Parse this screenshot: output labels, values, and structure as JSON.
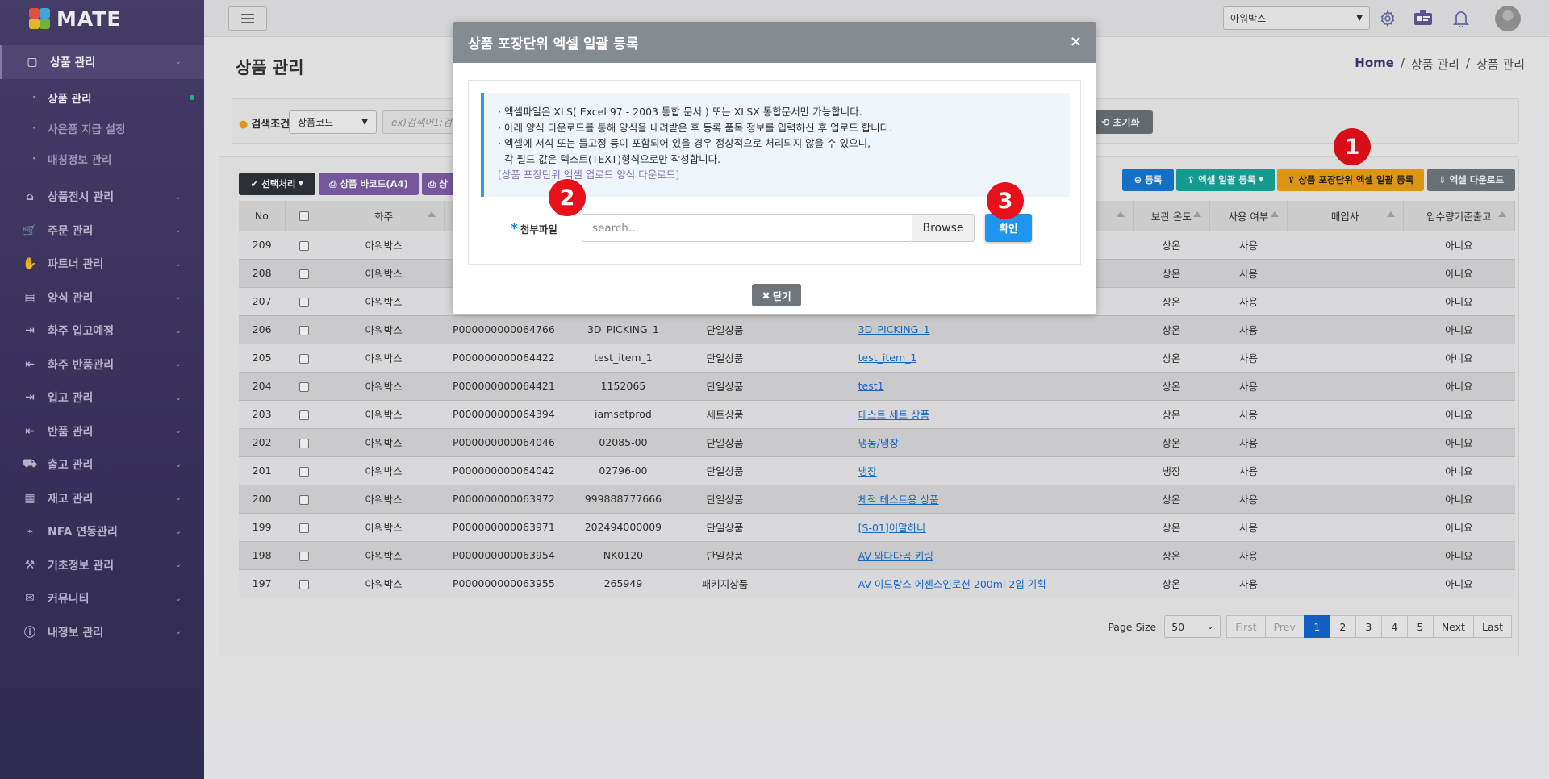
{
  "app": {
    "logo_text": "MATE"
  },
  "sidebar": {
    "items": [
      {
        "label": "상품 관리",
        "icon": "box-icon",
        "active": true,
        "children": [
          {
            "label": "상품 관리",
            "active": true
          },
          {
            "label": "사은품 지급 설정",
            "active": false
          },
          {
            "label": "매칭정보 관리",
            "active": false
          }
        ]
      },
      {
        "label": "상품전시 관리",
        "icon": "store-icon"
      },
      {
        "label": "주문 관리",
        "icon": "cart-icon"
      },
      {
        "label": "파트너 관리",
        "icon": "handshake-icon"
      },
      {
        "label": "양식 관리",
        "icon": "document-icon"
      },
      {
        "label": "화주 입고예정",
        "icon": "login-icon"
      },
      {
        "label": "화주 반품관리",
        "icon": "logout-icon"
      },
      {
        "label": "입고 관리",
        "icon": "login-icon"
      },
      {
        "label": "반품 관리",
        "icon": "logout-icon"
      },
      {
        "label": "출고 관리",
        "icon": "truck-icon"
      },
      {
        "label": "재고 관리",
        "icon": "boxes-icon"
      },
      {
        "label": "NFA 연동관리",
        "icon": "plug-icon"
      },
      {
        "label": "기초정보 관리",
        "icon": "wrench-icon"
      },
      {
        "label": "커뮤니티",
        "icon": "chat-icon"
      },
      {
        "label": "내정보 관리",
        "icon": "info-icon"
      }
    ]
  },
  "topbar": {
    "company_selected": "아워박스"
  },
  "page": {
    "title": "상품 관리",
    "breadcrumb": [
      "Home",
      "/",
      "상품 관리",
      "/",
      "상품 관리"
    ]
  },
  "search": {
    "label": "검색조건",
    "field_selected": "상품코드",
    "placeholder": "ex)검색어1;검색",
    "reset_label": "초기화"
  },
  "toolbar": {
    "select_action": "선택처리",
    "barcode_a4": "상품 바코드(A4)",
    "barcode_partial": "상",
    "register": "등록",
    "excel_bulk": "엑셀 일괄 등록",
    "package_excel_bulk": "상품 포장단위 엑셀 일괄 등록",
    "excel_download": "엑셀 다운로드"
  },
  "table": {
    "columns": [
      "No",
      "",
      "화주",
      "",
      "",
      "",
      "",
      "보관 온도",
      "사용 여부",
      "매입사",
      "입수량기준출고"
    ],
    "rows": [
      {
        "no": "209",
        "owner": "아워박스",
        "code": "",
        "sku": "",
        "type": "",
        "name": "",
        "temp": "상온",
        "use": "사용",
        "buyer": "",
        "qty": "아니요"
      },
      {
        "no": "208",
        "owner": "아워박스",
        "code": "",
        "sku": "",
        "type": "",
        "name": "",
        "temp": "상온",
        "use": "사용",
        "buyer": "",
        "qty": "아니요"
      },
      {
        "no": "207",
        "owner": "아워박스",
        "code": "",
        "sku": "",
        "type": "",
        "name": "",
        "temp": "상온",
        "use": "사용",
        "buyer": "",
        "qty": "아니요"
      },
      {
        "no": "206",
        "owner": "아워박스",
        "code": "P000000000064766",
        "sku": "3D_PICKING_1",
        "type": "단일상품",
        "name": "3D_PICKING_1",
        "temp": "상온",
        "use": "사용",
        "buyer": "",
        "qty": "아니요"
      },
      {
        "no": "205",
        "owner": "아워박스",
        "code": "P000000000064422",
        "sku": "test_item_1",
        "type": "단일상품",
        "name": "test_item_1",
        "temp": "상온",
        "use": "사용",
        "buyer": "",
        "qty": "아니요"
      },
      {
        "no": "204",
        "owner": "아워박스",
        "code": "P000000000064421",
        "sku": "1152065",
        "type": "단일상품",
        "name": "test1",
        "temp": "상온",
        "use": "사용",
        "buyer": "",
        "qty": "아니요"
      },
      {
        "no": "203",
        "owner": "아워박스",
        "code": "P000000000064394",
        "sku": "iamsetprod",
        "type": "세트상품",
        "name": "테스트 세트 상품",
        "temp": "상온",
        "use": "사용",
        "buyer": "",
        "qty": "아니요"
      },
      {
        "no": "202",
        "owner": "아워박스",
        "code": "P000000000064046",
        "sku": "02085-00",
        "type": "단일상품",
        "name": "냉동/냉장",
        "temp": "상온",
        "use": "사용",
        "buyer": "",
        "qty": "아니요"
      },
      {
        "no": "201",
        "owner": "아워박스",
        "code": "P000000000064042",
        "sku": "02796-00",
        "type": "단일상품",
        "name": "냉장",
        "temp": "냉장",
        "use": "사용",
        "buyer": "",
        "qty": "아니요"
      },
      {
        "no": "200",
        "owner": "아워박스",
        "code": "P000000000063972",
        "sku": "999888777666",
        "type": "단일상품",
        "name": "체적 테스트용 상품",
        "temp": "상온",
        "use": "사용",
        "buyer": "",
        "qty": "아니요"
      },
      {
        "no": "199",
        "owner": "아워박스",
        "code": "P000000000063971",
        "sku": "202494000009",
        "type": "단일상품",
        "name": "[S-01]이말하나",
        "temp": "상온",
        "use": "사용",
        "buyer": "",
        "qty": "아니요"
      },
      {
        "no": "198",
        "owner": "아워박스",
        "code": "P000000000063954",
        "sku": "NK0120",
        "type": "단일상품",
        "name": "AV 와다다곰 키링",
        "temp": "상온",
        "use": "사용",
        "buyer": "",
        "qty": "아니요"
      },
      {
        "no": "197",
        "owner": "아워박스",
        "code": "P000000000063955",
        "sku": "265949",
        "type": "패키지상품",
        "name": "AV 이드랑스 에센스인로션 200ml 2입 기획",
        "temp": "상온",
        "use": "사용",
        "buyer": "",
        "qty": "아니요"
      }
    ]
  },
  "pager": {
    "page_size_label": "Page Size",
    "page_size": "50",
    "first": "First",
    "prev": "Prev",
    "pages": [
      "1",
      "2",
      "3",
      "4",
      "5"
    ],
    "current": "1",
    "next": "Next",
    "last": "Last"
  },
  "modal": {
    "title": "상품 포장단위 엑셀 일괄 등록",
    "close_symbol": "×",
    "info_lines": [
      "· 엑셀파일은 XLS( Excel 97 - 2003 통합 문서 ) 또는 XLSX 통합문서만 가능합니다.",
      "· 아래 양식 다운로드를 통해 양식을 내려받은 후 등록 품목 정보를 입력하신 후 업로드 합니다.",
      "· 엑셀에 서식 또는 틀고정 등이 포함되어 있을 경우 정상적으로 처리되지 않을 수 있으니,",
      "  각 필드 값은 텍스트(TEXT)형식으로만 작성합니다."
    ],
    "download_link": "[상품 포장단위 엑셀 업로드 양식 다운로드]",
    "file_label": "첨부파일",
    "file_placeholder": "search...",
    "browse_label": "Browse",
    "confirm_label": "확인",
    "close_label": "닫기"
  },
  "markers": [
    "1",
    "2",
    "3"
  ],
  "colors": {
    "sidebar_bg": "#3d3563",
    "marker_red": "#e8101a",
    "confirm_blue": "#1e96f0",
    "accent_yellow": "#efa315"
  }
}
